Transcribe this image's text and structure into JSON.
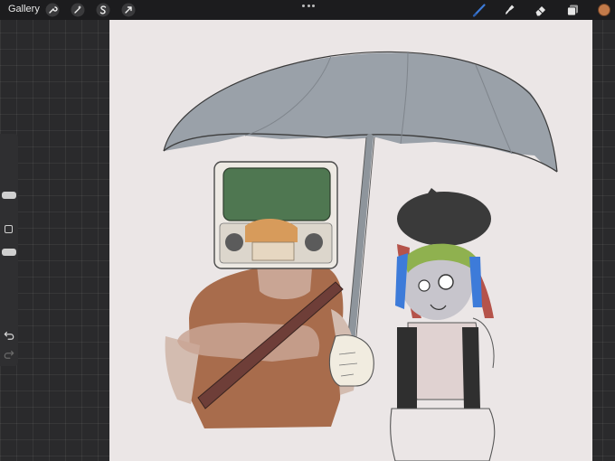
{
  "topbar": {
    "gallery_label": "Gallery",
    "left_tools": [
      "wrench-icon",
      "magic-wand-icon",
      "selection-s-icon",
      "transform-arrow-icon"
    ],
    "right_tools": [
      "brush-icon",
      "smudge-icon",
      "eraser-icon",
      "layers-icon"
    ],
    "active_tool": "brush-icon",
    "current_color": "#c27a4a"
  },
  "sidebar": {
    "controls": [
      "brush-size-slider",
      "modify-button",
      "opacity-slider",
      "undo-icon",
      "redo-icon"
    ]
  },
  "colors": {
    "canvas_background": "#ebe6e6",
    "umbrella": "#9aa1a9",
    "radio_screen": "#4f7751",
    "coat": "#a86c4c",
    "beret": "#3a3a3a",
    "accent_blue": "#3d7bd9"
  }
}
